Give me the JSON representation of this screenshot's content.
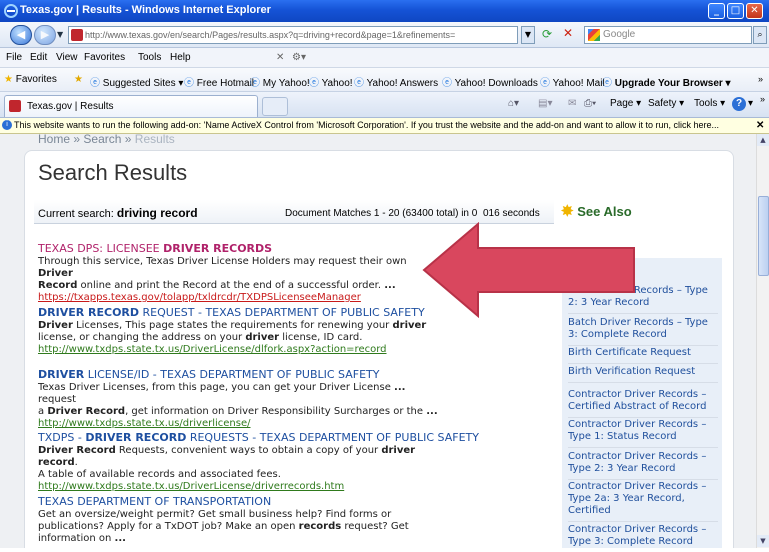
{
  "window": {
    "title": "Texas.gov | Results - Windows Internet Explorer"
  },
  "toolbar": {
    "address": "http://www.texas.gov/en/search/Pages/results.aspx?q=driving+record&page=1&refinements=",
    "address_domain": "texas.gov",
    "search_placeholder": "Google"
  },
  "menu": {
    "items": [
      "File",
      "Edit",
      "View",
      "Favorites",
      "Tools",
      "Help"
    ]
  },
  "favorites": {
    "label": "Favorites",
    "items": [
      "Suggested Sites",
      "Free Hotmail",
      "My Yahoo!",
      "Yahoo!",
      "Yahoo! Answers",
      "Yahoo! Downloads",
      "Yahoo! Mail",
      "Upgrade Your Browser"
    ]
  },
  "tab": {
    "title": "Texas.gov | Results"
  },
  "command_bar": {
    "page": "Page",
    "safety": "Safety",
    "tools": "Tools"
  },
  "infobar": {
    "text": "This website wants to run the following add-on: 'Name ActiveX Control from 'Microsoft Corporation'. If you trust the website and the add-on and want to allow it to run, click here..."
  },
  "page": {
    "breadcrumb": {
      "home": "Home",
      "sep": "»",
      "search": "Search",
      "results": "Results"
    },
    "heading": "Search Results",
    "current_search_label": "Current search:",
    "current_search_query": "driving record",
    "matches": "Document Matches 1 - 20 (63400 total) in 0",
    "seconds": "016 seconds",
    "see_also_title": "See Also"
  },
  "results": [
    {
      "title_a": "TEXAS DPS: LICENSEE ",
      "title_b": "DRIVER RECORDS",
      "desc_1": "Through this service, Texas Driver License Holders may request their own ",
      "desc_1b": "Driver",
      "desc_2a": "Record",
      "desc_2": " online and print the Record at the end of a successful order. ",
      "desc_2b": "...",
      "url": "https://txapps.texas.gov/tolapp/txldrcdr/TXDPSLicenseeManager"
    },
    {
      "title_a": "DRIVER RECORD",
      "title_b": " REQUEST - TEXAS DEPARTMENT OF PUBLIC SAFETY",
      "desc_1a": "Driver",
      "desc_1": " Licenses, This page states the requirements for renewing your ",
      "desc_1b": "driver",
      "desc_2": "license, or changing the address on your ",
      "desc_2b": "driver",
      "desc_2c": " license, ID card.",
      "url": "http://www.txdps.state.tx.us/DriverLicense/dlfork.aspx?action=record"
    },
    {
      "title_a": "DRIVER",
      "title_b": " LICENSE/ID - TEXAS DEPARTMENT OF PUBLIC SAFETY",
      "desc_1": "Texas Driver Licenses, from this page, you can get your Driver License ",
      "desc_1b": "...",
      "desc_1c": " request",
      "desc_2": "a ",
      "desc_2a": "Driver Record",
      "desc_2b": ", get information on Driver Responsibility Surcharges or the ",
      "desc_2c": "...",
      "url": "http://www.txdps.state.tx.us/driverlicense/"
    },
    {
      "title_a": "TXDPS - ",
      "title_b": "DRIVER RECORD",
      "title_c": " REQUESTS - TEXAS DEPARTMENT OF PUBLIC SAFETY",
      "desc_1a": "Driver Record",
      "desc_1": " Requests, convenient ways to obtain a copy of your ",
      "desc_1b": "driver record",
      "desc_1c": ".",
      "desc_2": "A table of available records and associated fees.",
      "url": "http://www.txdps.state.tx.us/DriverLicense/driverrecords.htm"
    },
    {
      "title": "TEXAS DEPARTMENT OF TRANSPORTATION",
      "desc_1": "Get an oversize/weight permit? Get small business help? Find forms or",
      "desc_2": "publications? Apply for a TxDOT job? Make an open ",
      "desc_2b": "records",
      "desc_2c": " request? Get",
      "desc_3": "information on ",
      "desc_3b": "..."
    }
  ],
  "see_also": [
    "cords – Type",
    "Batch Driver Records – Type 2: 3 Year Record",
    "Batch Driver Records – Type 3: Complete Record",
    "Birth Certificate Request",
    "Birth Verification Request",
    "Contractor Driver Records – Certified Abstract of Record",
    "Contractor Driver Records – Type 1: Status Record",
    "Contractor Driver Records – Type 2: 3 Year Record",
    "Contractor Driver Records – Type 2a: 3 Year Record, Certified",
    "Contractor Driver Records – Type 3: Complete Record"
  ],
  "colors": {
    "titlebar": "#1553d6",
    "arrow": "#d9475e",
    "link_blue": "#1e4fa0",
    "url_green": "#2f7a1c",
    "url_red": "#c81a1a",
    "title_pink": "#b0226a"
  }
}
